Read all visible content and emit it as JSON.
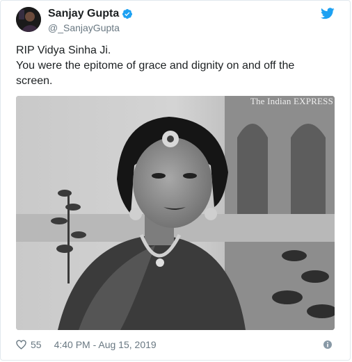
{
  "author": {
    "name": "Sanjay Gupta",
    "handle": "@_SanjayGupta",
    "verified_icon": "verified-badge-icon"
  },
  "tweet": {
    "lines": [
      "RIP Vidya Sinha Ji.",
      "You were the epitome of grace and dignity on and off the",
      "screen."
    ]
  },
  "photo": {
    "watermark": "The Indian EXPRESS"
  },
  "footer": {
    "likes": "55",
    "timestamp": "4:40 PM - Aug 15, 2019",
    "like_icon": "heart-icon",
    "info_icon": "info-icon"
  },
  "colors": {
    "twitter_blue": "#1da1f2",
    "text": "#1c2022",
    "muted": "#697882",
    "border": "#e1e8ed"
  }
}
